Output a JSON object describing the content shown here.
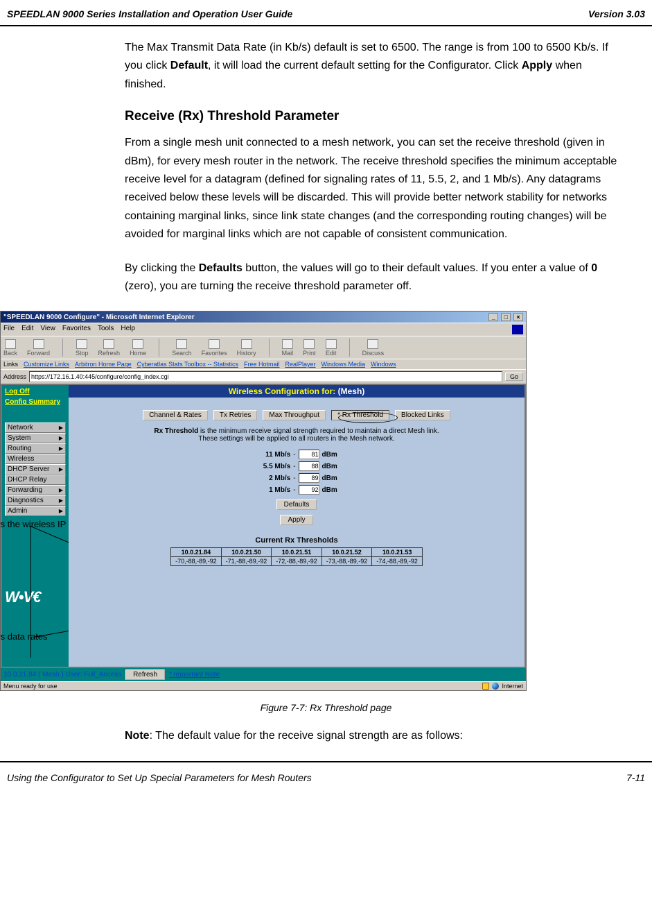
{
  "header": {
    "left": "SPEEDLAN 9000 Series Installation and Operation User Guide",
    "right": "Version 3.03"
  },
  "paras": {
    "p1a": "The Max Transmit Data Rate (in Kb/s) default is set to 6500. The range is from 100 to 6500 Kb/s. If you click ",
    "p1b": "Default",
    "p1c": ", it will load the current default setting for the Configurator. Click ",
    "p1d": "Apply",
    "p1e": " when finished."
  },
  "h3": "Receive (Rx) Threshold Parameter",
  "p2": "From a single mesh unit connected to a mesh network, you can set the receive threshold (given in dBm), for every mesh router in the network. The receive threshold specifies the minimum acceptable receive level for a datagram (defined for signaling rates of 11, 5.5, 2, and 1 Mb/s). Any datagrams received below these levels will be discarded. This will provide better network stability for networks containing marginal links, since link state changes (and the corresponding routing changes) will be avoided for marginal links which are not capable of consistent communication.",
  "p3a": "By clicking the ",
  "p3b": "Defaults",
  "p3c": " button, the values will go to their default values. If you enter a value of ",
  "p3d": "0",
  "p3e": " (zero), you are turning the receive threshold parameter off.",
  "callout1": "Displays the wireless IP address",
  "callout2": "Displays data rates",
  "browser": {
    "title": "\"SPEEDLAN 9000 Configure\" - Microsoft Internet Explorer",
    "menus": [
      "File",
      "Edit",
      "View",
      "Favorites",
      "Tools",
      "Help"
    ],
    "toolbar": [
      "Back",
      "Forward",
      "Stop",
      "Refresh",
      "Home",
      "Search",
      "Favorites",
      "History",
      "Mail",
      "Print",
      "Edit",
      "Discuss"
    ],
    "links_label": "Links",
    "links": [
      "Customize Links",
      "Arbitron Home Page",
      "Cyberatlas Stats Toolbox -- Statistics",
      "Free Hotmail",
      "RealPlayer",
      "Windows Media",
      "Windows"
    ],
    "addr_label": "Address",
    "addr_value": "https://172.16.1.40:445/configure/config_index.cgi",
    "go": "Go",
    "status_left": "Menu ready for use",
    "status_right": "Internet"
  },
  "sidebar": {
    "logoff": "Log Off",
    "summary": "Config Summary",
    "items": [
      "Network",
      "System",
      "Routing",
      "Wireless",
      "DHCP Server",
      "DHCP Relay",
      "Forwarding",
      "Diagnostics",
      "Admin"
    ]
  },
  "conf": {
    "title_pre": "Wireless Configuration for:",
    "title_post": " (Mesh)",
    "tabs": [
      "Channel & Rates",
      "Tx Retries",
      "Max Throughput",
      "* Rx Threshold",
      "Blocked Links"
    ],
    "info1": "Rx Threshold",
    "info2": " is the minimum receive signal strength required to maintain a direct Mesh link.",
    "info3": "These settings will be applied to all routers in the Mesh network.",
    "rows": [
      {
        "label": "11 Mb/s",
        "val": "81",
        "unit": "dBm"
      },
      {
        "label": "5.5 Mb/s",
        "val": "88",
        "unit": "dBm"
      },
      {
        "label": "2 Mb/s",
        "val": "89",
        "unit": "dBm"
      },
      {
        "label": "1 Mb/s",
        "val": "92",
        "unit": "dBm"
      }
    ],
    "defaults_btn": "Defaults",
    "apply_btn": "Apply",
    "section_title": "Current Rx Thresholds",
    "table_head": [
      "10.0.21.84",
      "10.0.21.50",
      "10.0.21.51",
      "10.0.21.52",
      "10.0.21.53"
    ],
    "table_row": [
      "-70,-88,-89,-92",
      "-71,-88,-89,-92",
      "-72,-88,-89,-92",
      "-73,-88,-89,-92",
      "-74,-88,-89,-92"
    ],
    "footer_user": "10.0.21.84 ( Mesh ) User: Full_Access",
    "refresh": "Refresh",
    "important": "* Important Note"
  },
  "figcap": "Figure 7-7: Rx Threshold page",
  "note_label": "Note",
  "note_text": ": The default value for the receive signal strength are as follows:",
  "footer": {
    "left": "Using the Configurator to Set Up Special Parameters for Mesh Routers",
    "right": "7-11"
  }
}
